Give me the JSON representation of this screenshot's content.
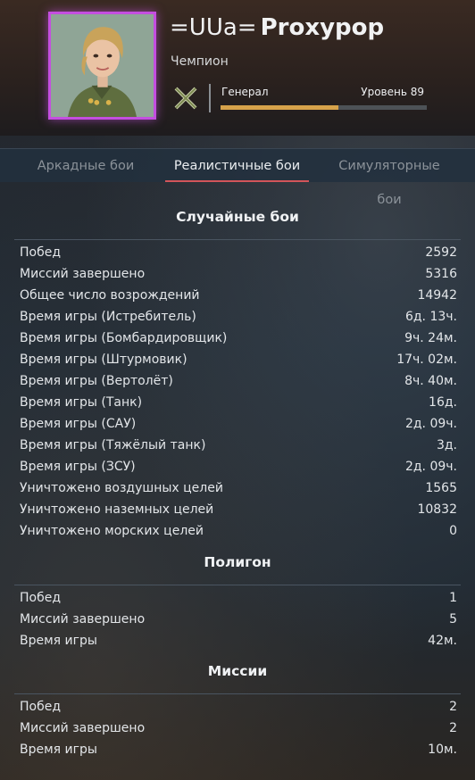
{
  "profile": {
    "clan_tag": "=UUa=",
    "nickname": "Proxypop",
    "title": "Чемпион",
    "rank": "Генерал",
    "level": "Уровень 89",
    "level_progress": 0.57,
    "frame_color": "#c44ee0",
    "xp_color": "#d6a24a"
  },
  "tabs": [
    {
      "label": "Аркадные бои",
      "active": false
    },
    {
      "label": "Реалистичные бои",
      "active": true
    },
    {
      "label": "Симуляторные бои",
      "active": false
    }
  ],
  "sections": {
    "random": {
      "title": "Случайные бои",
      "rows": [
        {
          "label": "Побед",
          "value": "2592"
        },
        {
          "label": "Миссий завершено",
          "value": "5316"
        },
        {
          "label": "Общее число возрождений",
          "value": "14942"
        },
        {
          "label": "Время игры (Истребитель)",
          "value": "6д. 13ч."
        },
        {
          "label": "Время игры (Бомбардировщик)",
          "value": "9ч. 24м."
        },
        {
          "label": "Время игры (Штурмовик)",
          "value": "17ч. 02м."
        },
        {
          "label": "Время игры (Вертолёт)",
          "value": "8ч. 40м."
        },
        {
          "label": "Время игры (Танк)",
          "value": "16д."
        },
        {
          "label": "Время игры (САУ)",
          "value": "2д. 09ч."
        },
        {
          "label": "Время игры (Тяжёлый танк)",
          "value": "3д."
        },
        {
          "label": "Время игры (ЗСУ)",
          "value": "2д. 09ч."
        },
        {
          "label": "Уничтожено воздушных целей",
          "value": "1565"
        },
        {
          "label": "Уничтожено наземных целей",
          "value": "10832"
        },
        {
          "label": "Уничтожено морских целей",
          "value": "0"
        }
      ]
    },
    "polygon": {
      "title": "Полигон",
      "rows": [
        {
          "label": "Побед",
          "value": "1"
        },
        {
          "label": "Миссий завершено",
          "value": "5"
        },
        {
          "label": "Время игры",
          "value": "42м."
        }
      ]
    },
    "missions": {
      "title": "Миссии",
      "rows": [
        {
          "label": "Побед",
          "value": "2"
        },
        {
          "label": "Миссий завершено",
          "value": "2"
        },
        {
          "label": "Время игры",
          "value": "10м."
        }
      ]
    }
  }
}
